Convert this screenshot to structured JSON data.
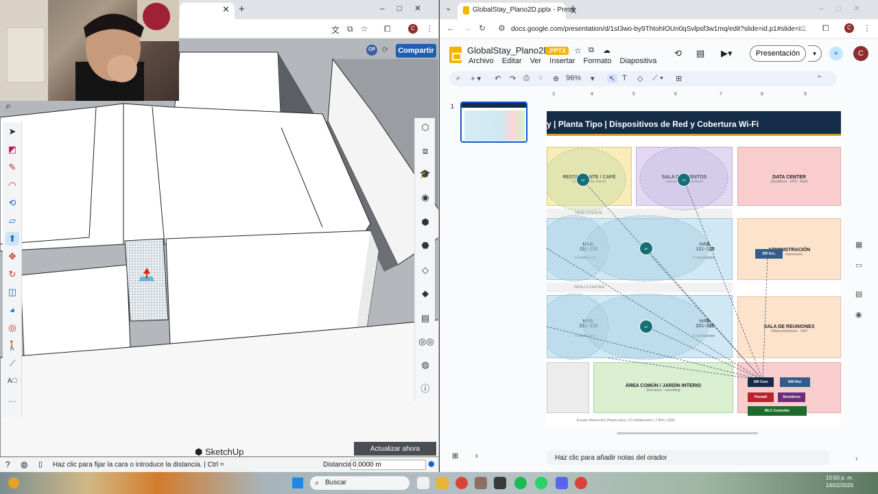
{
  "sketchup": {
    "share_label": "Compartir",
    "avatar_initials": "CP",
    "brand": "SketchUp",
    "update_label": "Actualizar ahora",
    "status_text": "Haz clic para fijar la cara o introduce la distancia. | Ctrl =",
    "distance_label": "Distancia",
    "distance_value": "0.0000 m"
  },
  "slides": {
    "tab_title": "GlobalStay_Plano2D.pptx - Pres",
    "url": "docs.google.com/presentation/d/1sI3wo-by9ThtohIOUn0qSvlpsf3w1mq/edit?slide=id.p1#slide=i...",
    "doc_title": "GlobalStay_Plano2D",
    "badge": ".PPTX",
    "menu": [
      "Archivo",
      "Editar",
      "Ver",
      "Insertar",
      "Formato",
      "Diapositiva"
    ],
    "present_label": "Presentación",
    "user_initial": "C",
    "zoom": "96%",
    "ruler_ticks": [
      "3",
      "4",
      "5",
      "6",
      "7",
      "8",
      "9"
    ],
    "slide_number": "1",
    "notes_placeholder": "Haz clic para añadir notas del orador",
    "slide": {
      "header": "y  |  Planta Tipo  |  Dispositivos de Red y Cobertura Wi-Fi",
      "rooms": [
        {
          "name": "RESTAURANTE / CAFÉ",
          "sub": "Comedor · Bar interior",
          "color": "#f8edb8"
        },
        {
          "name": "SALA DE EVENTOS",
          "sub": "Capacidad · Proyectores",
          "color": "#e3d8ef"
        },
        {
          "name": "DATA CENTER",
          "sub": "Servidores · UPS · Rack",
          "color": "#f9ccce"
        },
        {
          "name": "HAB. 111–115",
          "sub": "5 habitaciones",
          "color": "#cfe8f3"
        },
        {
          "name": "HAB. 121–125",
          "sub": "5 habitaciones",
          "color": "#cfe8f3"
        },
        {
          "name": "ADMINISTRACIÓN",
          "sub": "PCs · Impresoras",
          "color": "#fde3cc"
        },
        {
          "name": "HAB. 211–215",
          "sub": "5 habitaciones",
          "color": "#cfe8f3"
        },
        {
          "name": "HAB. 221–225",
          "sub": "5 habitaciones",
          "color": "#cfe8f3"
        },
        {
          "name": "SALA DE REUNIONES",
          "sub": "Videoconferencia · VoIP",
          "color": "#fde3cc"
        },
        {
          "name": "ÁREA COMÚN / JARDÍN INTERIO",
          "sub": "Descanso · coworking",
          "color": "#d9efd0"
        }
      ],
      "devices": {
        "sw_acc": "SW Acc.",
        "sw_core": "SW Core",
        "sw_dist": "SW Dist.",
        "firewall": "Firewall",
        "servers": "Servidores",
        "wlc": "WLC Controller"
      },
      "corridor": "PASILLO NORTE",
      "corridor2": "PASILLO CENTRAL",
      "footer": "Escala referencial  |  Planta única  |  10 habitaciones  |  7 APs  |  2026"
    }
  },
  "taskbar": {
    "search_placeholder": "Buscar",
    "time": "10:50 p. m.",
    "date": "14/02/2026"
  },
  "colors": {
    "share_blue": "#1f5fb0",
    "slide_header": "#152c49",
    "ap_teal": "#176f76",
    "gold": "#d49b2a"
  }
}
